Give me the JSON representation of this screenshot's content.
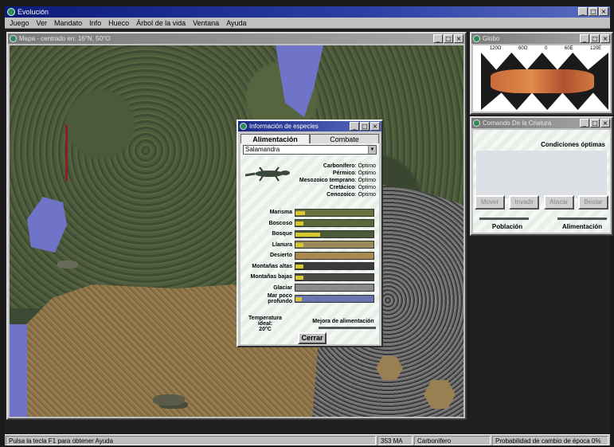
{
  "app": {
    "title": "Evolución"
  },
  "menu": [
    "Juego",
    "Ver",
    "Mandato",
    "Info",
    "Hueco",
    "Árbol de la vida",
    "Ventana",
    "Ayuda"
  ],
  "map_window": {
    "title": "Mapa - centrado en: 16°N, 50°O"
  },
  "species_dialog": {
    "title": "Información de especies",
    "tabs": [
      "Alimentación",
      "Combate"
    ],
    "active_tab": "Alimentación",
    "species_select": "Salamandra",
    "epochs": [
      {
        "name": "Carbonífero",
        "status": "Óptimo"
      },
      {
        "name": "Pérmico",
        "status": "Óptimo"
      },
      {
        "name": "Mesozoico temprano",
        "status": "Óptimo"
      },
      {
        "name": "Cretácico",
        "status": "Óptimo"
      },
      {
        "name": "Cenozoico",
        "status": "Óptimo"
      }
    ],
    "habitats": [
      {
        "name": "Marisma",
        "level": 0.12,
        "color": "#6a7040"
      },
      {
        "name": "Boscoso",
        "level": 0.1,
        "color": "#5a6838"
      },
      {
        "name": "Bosque",
        "level": 0.32,
        "color": "#4a5a38"
      },
      {
        "name": "Llanura",
        "level": 0.1,
        "color": "#9a8a58"
      },
      {
        "name": "Desierto",
        "level": 0.0,
        "color": "#a88a50"
      },
      {
        "name": "Montañas altas",
        "level": 0.1,
        "color": "#3a3a3a"
      },
      {
        "name": "Montañas bajas",
        "level": 0.1,
        "color": "#4a4a44"
      },
      {
        "name": "Glaciar",
        "level": 0.0,
        "color": "#8a8a88"
      },
      {
        "name": "Mar poco profundo",
        "level": 0.08,
        "color": "#6a74b0"
      }
    ],
    "ideal_label": "Temperatura ideal:",
    "ideal_value": "20°C",
    "mejora_label": "Mejora de alimentación",
    "close_label": "Cerrar"
  },
  "globe_window": {
    "title": "Globo",
    "ticks": [
      "120O",
      "60O",
      "0",
      "60E",
      "120E"
    ]
  },
  "command_window": {
    "title": "Comando De la Criatura",
    "conditions": "Condiciones óptimas",
    "buttons": [
      "Mover",
      "Invadir",
      "Atacar",
      "Bestar"
    ],
    "labels": [
      "Población",
      "Alimentación"
    ]
  },
  "status": {
    "help": "Pulsa la tecla F1 para obtener Ayuda",
    "time": "353 MA",
    "period": "Carbonífero",
    "epoch_change": "Probabilidad de cambio de época 0%"
  }
}
